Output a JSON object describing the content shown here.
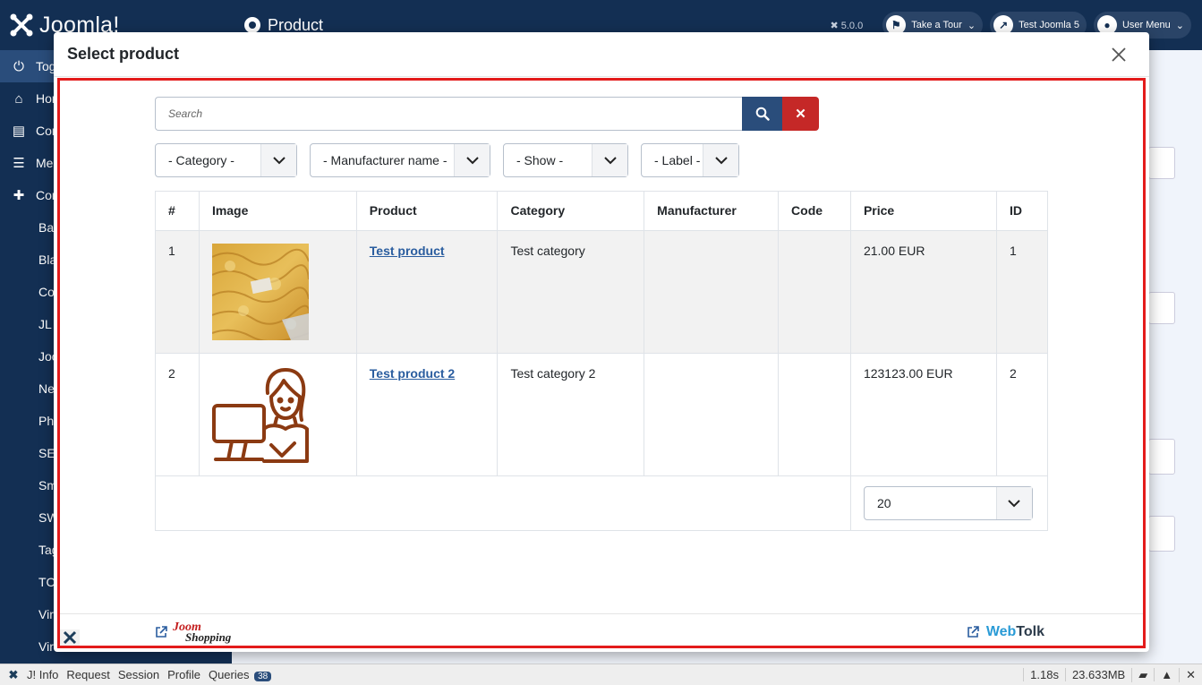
{
  "app": {
    "logo_text": "Joomla!",
    "page_title": "Product",
    "version": "5.0.0",
    "header_buttons": [
      {
        "label": "Take a Tour"
      },
      {
        "label": "Test Joomla 5"
      },
      {
        "label": "User Menu"
      }
    ]
  },
  "sidebar": {
    "items": [
      {
        "label": "Toggle Menu",
        "icon": "toggle-icon"
      },
      {
        "label": "Home Dashboard",
        "icon": "home-icon"
      },
      {
        "label": "Content",
        "icon": "file-icon"
      },
      {
        "label": "Menus",
        "icon": "list-icon"
      },
      {
        "label": "Components",
        "icon": "puzzle-icon"
      }
    ],
    "sub_items": [
      "Banners",
      "Blank Component",
      "Contacts",
      "JL Content Fields Filter",
      "Joomshopping",
      "News Feeds",
      "Phoca",
      "SEF",
      "Smart Search",
      "SW JProjects",
      "Tags",
      "TCSTORE",
      "VirtueMart",
      "Virtuemart"
    ]
  },
  "modal": {
    "title": "Select product",
    "search": {
      "placeholder": "Search"
    },
    "filters": [
      {
        "label": "- Category -"
      },
      {
        "label": "- Manufacturer name -"
      },
      {
        "label": "- Show -"
      },
      {
        "label": "- Label -"
      }
    ],
    "table": {
      "headers": [
        "#",
        "Image",
        "Product",
        "Category",
        "Manufacturer",
        "Code",
        "Price",
        "ID"
      ],
      "rows": [
        {
          "num": "1",
          "image": "knitted-fabric-photo",
          "product": "Test product",
          "category": "Test category",
          "manufacturer": "",
          "code": "",
          "price": "21.00 EUR",
          "id": "1"
        },
        {
          "num": "2",
          "image": "person-at-computer-icon",
          "product": "Test product 2",
          "category": "Test category 2",
          "manufacturer": "",
          "code": "",
          "price": "123123.00 EUR",
          "id": "2"
        }
      ],
      "limit": "20"
    },
    "footer": {
      "joomshopping_top": "Joom",
      "joomshopping_bottom": "Shopping",
      "webtolk_a": "Web",
      "webtolk_b": "Tolk"
    }
  },
  "debugbar": {
    "items": [
      "J! Info",
      "Request",
      "Session",
      "Profile",
      "Queries"
    ],
    "queries_count": "38",
    "time": "1.18s",
    "memory": "23.633MB"
  },
  "colors": {
    "nav": "#132f53",
    "accent": "#2a4d7b",
    "danger": "#c52827",
    "highlight": "#e31b1b"
  }
}
